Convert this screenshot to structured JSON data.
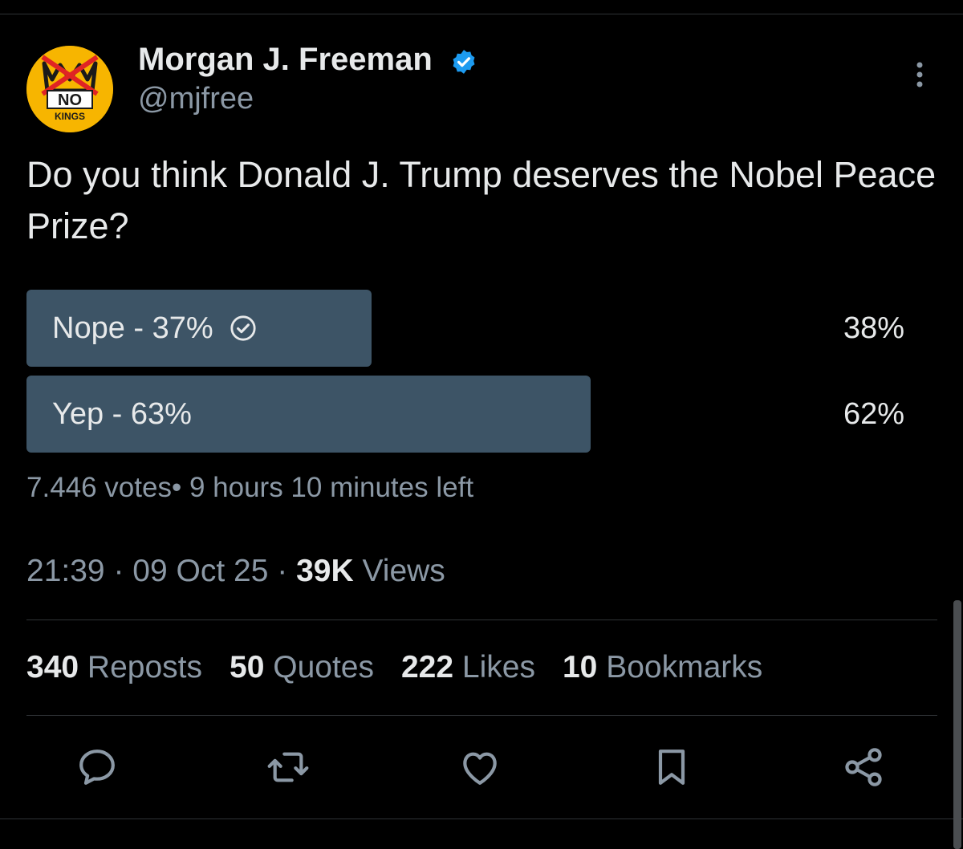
{
  "author": {
    "name": "Morgan J. Freeman",
    "handle": "@mjfree",
    "avatar_text": "NO",
    "avatar_subtext": "KINGS",
    "verified": true
  },
  "tweet": {
    "text": "Do you think Donald J. Trump deserves the Nobel Peace Prize?"
  },
  "poll": {
    "options": [
      {
        "label": "Nope - 37%",
        "percent_label": "38%",
        "percent": 38,
        "selected": true
      },
      {
        "label": "Yep - 63%",
        "percent_label": "62%",
        "percent": 62,
        "selected": false
      }
    ],
    "votes": "7.446 votes",
    "time_left": "9 hours 10 minutes left"
  },
  "meta": {
    "time": "21:39",
    "date": "09 Oct 25",
    "views_count": "39K",
    "views_label": "Views",
    "separator": "·"
  },
  "stats": {
    "reposts_count": "340",
    "reposts_label": "Reposts",
    "quotes_count": "50",
    "quotes_label": "Quotes",
    "likes_count": "222",
    "likes_label": "Likes",
    "bookmarks_count": "10",
    "bookmarks_label": "Bookmarks"
  },
  "icons": {
    "reply": "reply-icon",
    "repost": "repost-icon",
    "like": "heart-icon",
    "bookmark": "bookmark-icon",
    "share": "share-icon",
    "more": "more-vertical-icon",
    "verified": "verified-badge-icon",
    "selected": "check-circle-icon"
  },
  "colors": {
    "background": "#000000",
    "poll_bar": "#3d5466",
    "verified": "#1d9bf0",
    "muted_text": "#8b98a5",
    "avatar": "#f7b500"
  }
}
